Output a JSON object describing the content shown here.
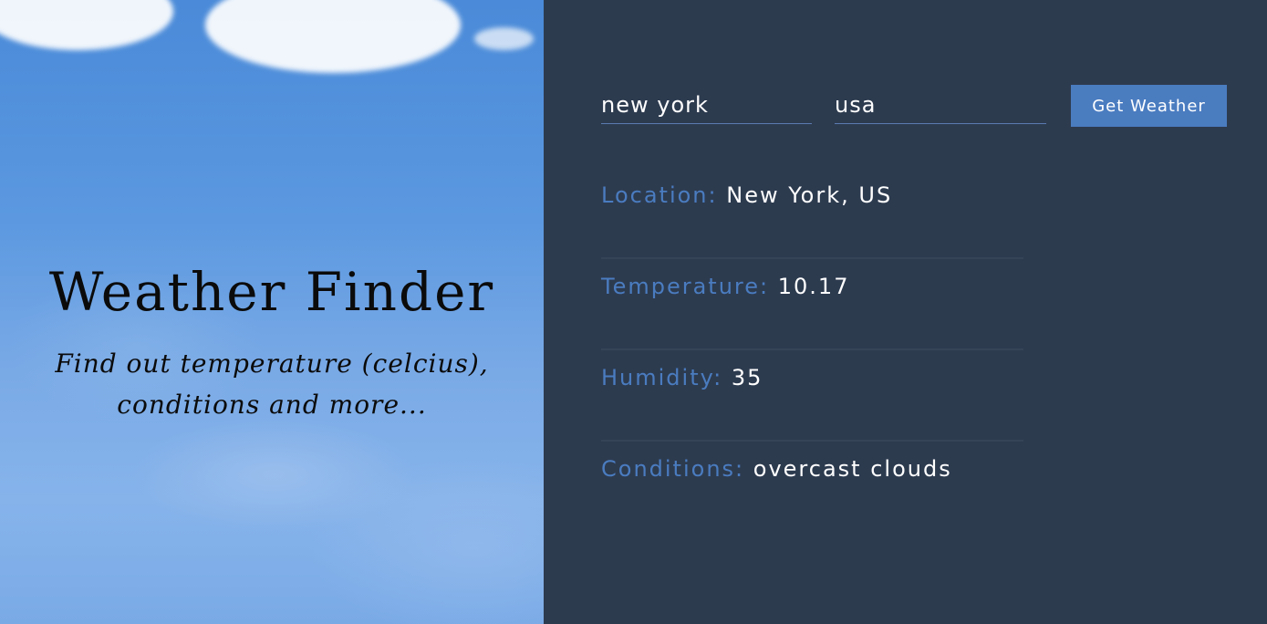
{
  "hero": {
    "title": "Weather Finder",
    "subtitle_line1": "Find out temperature (celcius),",
    "subtitle_line2": "conditions and more..."
  },
  "form": {
    "city_value": "new york",
    "country_value": "usa",
    "submit_label": "Get Weather"
  },
  "results": {
    "location": {
      "label": "Location:",
      "value": "New York, US"
    },
    "temperature": {
      "label": "Temperature:",
      "value": "10.17"
    },
    "humidity": {
      "label": "Humidity:",
      "value": "35"
    },
    "conditions": {
      "label": "Conditions:",
      "value": "overcast clouds"
    }
  },
  "colors": {
    "panel_bg": "#2d3b4f",
    "accent": "#4a7cc0",
    "value_text": "#ffffff",
    "hero_text": "#0b0b0b"
  }
}
